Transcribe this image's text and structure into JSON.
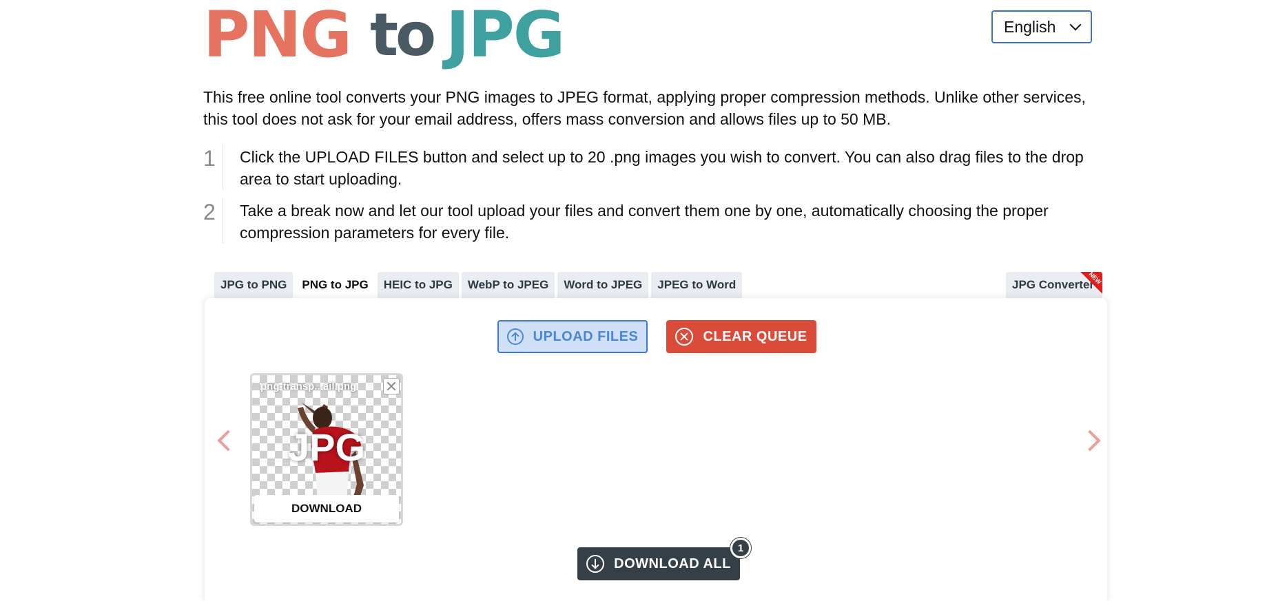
{
  "header": {
    "logo": {
      "part1": "PNG",
      "part2": "to",
      "part3": "JPG"
    },
    "language": "English"
  },
  "intro": "This free online tool converts your PNG images to JPEG format, applying proper compression methods. Unlike other services, this tool does not ask for your email address, offers mass conversion and allows files up to 50 MB.",
  "steps": [
    {
      "num": "1",
      "text": "Click the UPLOAD FILES button and select up to 20 .png images you wish to convert. You can also drag files to the drop area to start uploading."
    },
    {
      "num": "2",
      "text": "Take a break now and let our tool upload your files and convert them one by one, automatically choosing the proper compression parameters for every file."
    }
  ],
  "tabs": [
    {
      "label": "JPG to PNG"
    },
    {
      "label": "PNG to JPG",
      "active": true
    },
    {
      "label": "HEIC to JPG"
    },
    {
      "label": "WebP to JPEG"
    },
    {
      "label": "Word to JPEG"
    },
    {
      "label": "JPEG to Word"
    }
  ],
  "tab_right": {
    "label": "JPG Converter",
    "badge": "NEW"
  },
  "toolbar": {
    "upload_label": "UPLOAD FILES",
    "clear_label": "CLEAR QUEUE"
  },
  "file": {
    "name": "png-transp...ail.png",
    "badge": "JPG",
    "download_label": "DOWNLOAD"
  },
  "download_all": {
    "label": "DOWNLOAD ALL",
    "count": "1"
  },
  "colors": {
    "png": "#e5735f",
    "to": "#4a5a64",
    "jpg": "#3fa19f",
    "clear": "#db4b3a",
    "download_all": "#343f48"
  }
}
